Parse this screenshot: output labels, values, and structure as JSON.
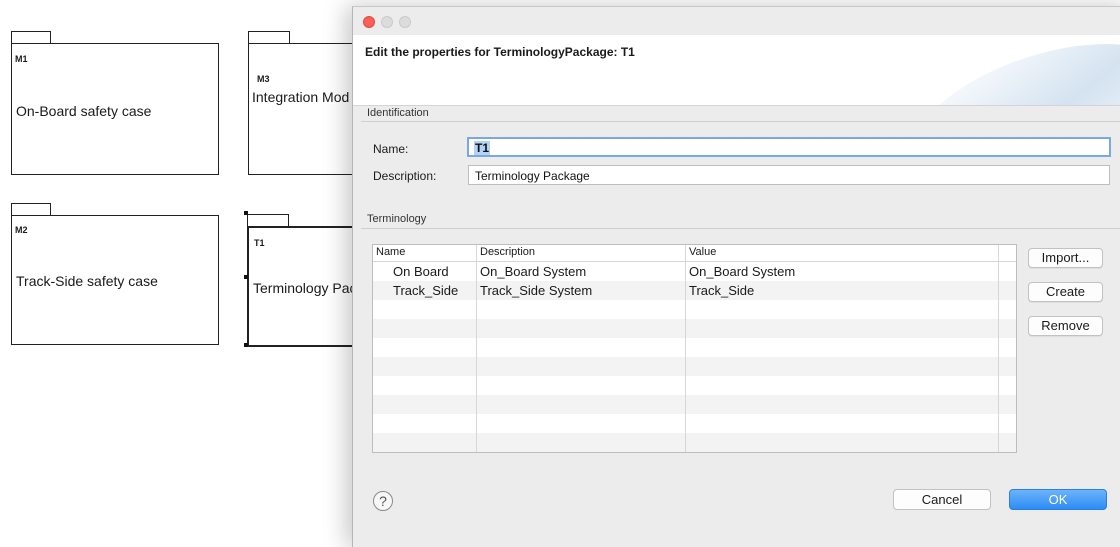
{
  "diagram": {
    "packages": [
      {
        "id": "M1",
        "title": "On-Board safety case"
      },
      {
        "id": "M3",
        "title": "Integration Mod"
      },
      {
        "id": "M2",
        "title": "Track-Side safety case"
      },
      {
        "id": "T1",
        "title": "Terminology Pac"
      }
    ]
  },
  "dialog": {
    "message": "Edit the properties for TerminologyPackage: T1",
    "identification": {
      "section_label": "Identification",
      "name_label": "Name:",
      "name_value": "T1",
      "description_label": "Description:",
      "description_value": "Terminology Package"
    },
    "terminology": {
      "section_label": "Terminology",
      "columns": [
        "Name",
        "Description",
        "Value"
      ],
      "rows": [
        {
          "name": "On Board",
          "description": "On_Board System",
          "value": "On_Board System"
        },
        {
          "name": "Track_Side",
          "description": "Track_Side System",
          "value": "Track_Side"
        }
      ],
      "buttons": {
        "import": "Import...",
        "create": "Create",
        "remove": "Remove"
      }
    },
    "footer": {
      "help_glyph": "?",
      "cancel": "Cancel",
      "ok": "OK"
    },
    "colors": {
      "accent": "#2d8cf6",
      "close": "#fc5f57",
      "selection": "#b4d2f5"
    }
  }
}
